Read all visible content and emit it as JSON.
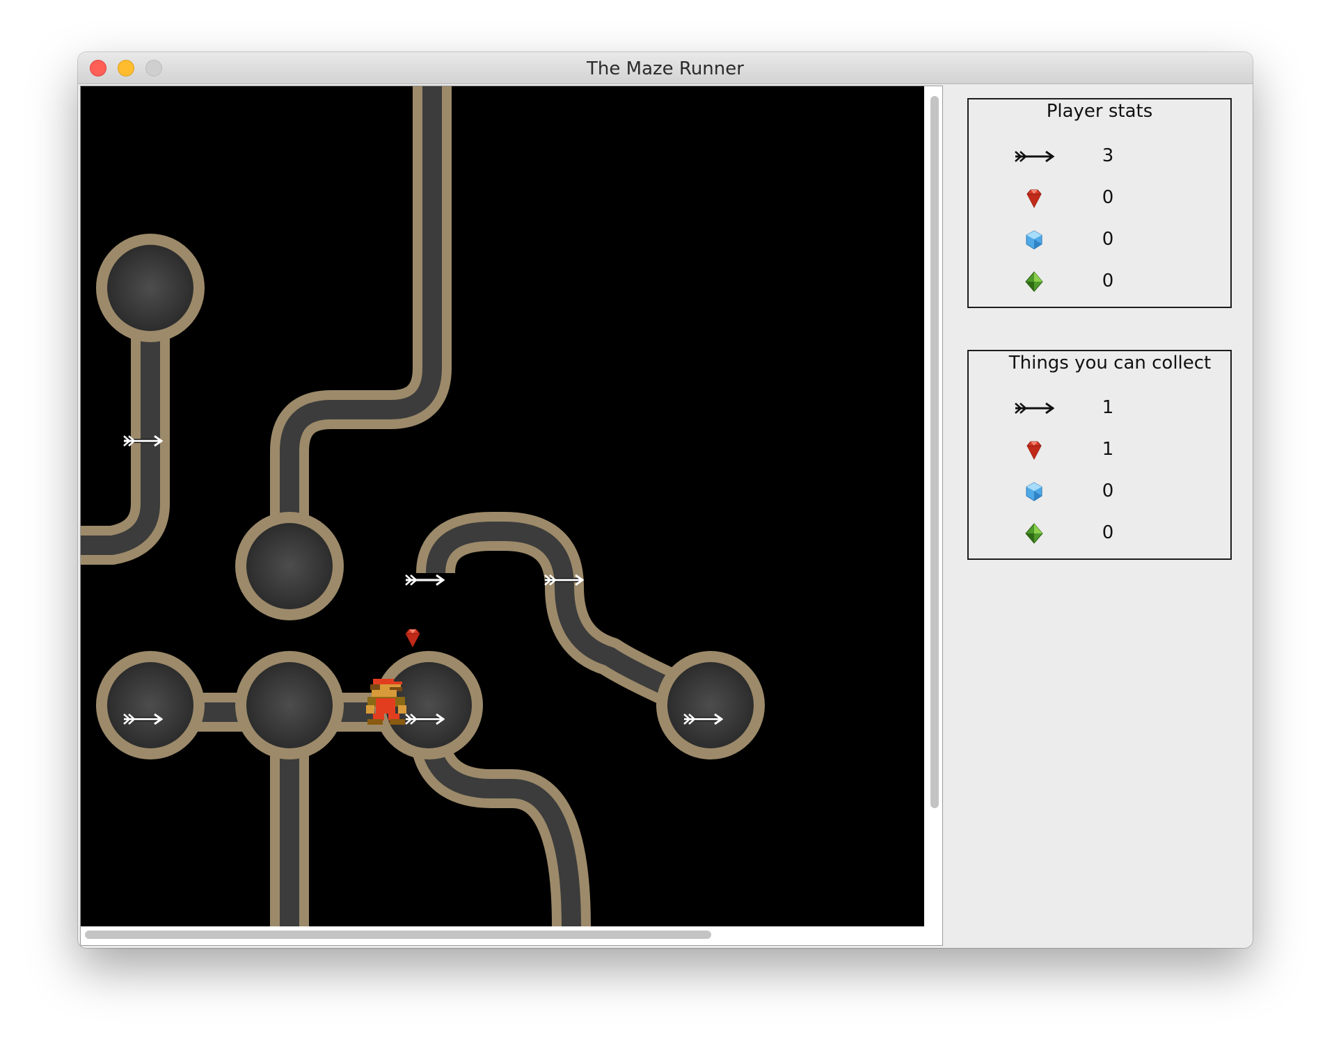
{
  "window": {
    "title": "The Maze Runner"
  },
  "player_stats": {
    "title": "Player stats",
    "rows": [
      {
        "icon": "arrow-icon",
        "value": "3"
      },
      {
        "icon": "red-gem-icon",
        "value": "0"
      },
      {
        "icon": "blue-gem-icon",
        "value": "0"
      },
      {
        "icon": "green-gem-icon",
        "value": "0"
      }
    ]
  },
  "collectables": {
    "title": "Things you can collect",
    "rows": [
      {
        "icon": "arrow-icon",
        "value": "1"
      },
      {
        "icon": "red-gem-icon",
        "value": "1"
      },
      {
        "icon": "blue-gem-icon",
        "value": "0"
      },
      {
        "icon": "green-gem-icon",
        "value": "0"
      }
    ]
  },
  "colors": {
    "maze_background": "#000000",
    "corridor_border": "#9c8a6a",
    "corridor_floor": "#3c3c3c",
    "panel_border": "#1c1c1c"
  },
  "maze_items": [
    {
      "type": "arrow"
    },
    {
      "type": "arrow"
    },
    {
      "type": "arrow"
    },
    {
      "type": "arrow"
    },
    {
      "type": "arrow"
    },
    {
      "type": "arrow"
    },
    {
      "type": "red-gem"
    }
  ],
  "player": {
    "sprite": "mario-icon"
  }
}
